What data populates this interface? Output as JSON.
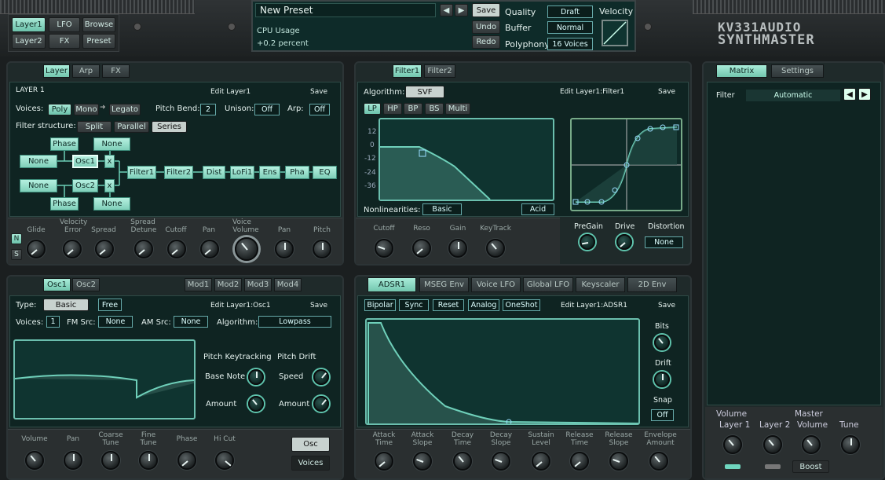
{
  "top": {
    "tabs": [
      "Layer1",
      "LFO",
      "Browse",
      "Layer2",
      "FX",
      "Preset"
    ],
    "active": "Layer1",
    "preset_name": "New Preset",
    "save": "Save",
    "undo": "Undo",
    "redo": "Redo",
    "cpu_label": "CPU Usage",
    "cpu_value": "+0.2 percent",
    "quality_label": "Quality",
    "quality": "Draft",
    "buffer_label": "Buffer",
    "buffer": "Normal",
    "polyphony_label": "Polyphony",
    "polyphony": "16 Voices",
    "velocity_label": "Velocity",
    "logo_top": "KV331AUDIO",
    "logo_bottom": "SYNTHMASTER"
  },
  "layer": {
    "tabs": [
      "Layer",
      "Arp",
      "FX"
    ],
    "title": "LAYER 1",
    "edit": "Edit Layer1",
    "save": "Save",
    "voices_label": "Voices:",
    "poly": "Poly",
    "mono": "Mono",
    "legato": "Legato",
    "pitch_bend_label": "Pitch Bend:",
    "pitch_bend": "2",
    "unison_label": "Unison:",
    "unison": "Off",
    "arp_label": "Arp:",
    "arp": "Off",
    "filter_structure_label": "Filter structure:",
    "split": "Split",
    "parallel": "Parallel",
    "series": "Series",
    "nodes": {
      "phase1": "Phase",
      "none1": "None",
      "noneA": "None",
      "osc1": "Osc1",
      "x1": "x",
      "filter1": "Filter1",
      "filter2": "Filter2",
      "dist": "Dist",
      "lofi": "LoFi1",
      "ens": "Ens",
      "pha": "Pha",
      "eq": "EQ",
      "noneB": "None",
      "osc2": "Osc2",
      "x2": "x",
      "phase2": "Phase",
      "none2": "None"
    },
    "groups": [
      "Velocity",
      "Spread",
      "Voice"
    ],
    "knobs": [
      "Glide",
      "Error",
      "Spread",
      "Detune",
      "Cutoff",
      "Pan",
      "Volume",
      "Pan",
      "Pitch"
    ],
    "n": "N",
    "s": "S"
  },
  "filter": {
    "tabs": [
      "Filter1",
      "Filter2"
    ],
    "algorithm_label": "Algorithm:",
    "algorithm": "SVF",
    "types": [
      "LP",
      "HP",
      "BP",
      "BS",
      "Multi"
    ],
    "edit": "Edit Layer1:Filter1",
    "save": "Save",
    "db": [
      "12",
      "0",
      "-12",
      "-24",
      "-36"
    ],
    "nonlin_label": "Nonlinearities:",
    "nonlin": "Basic",
    "acid": "Acid",
    "knobs": [
      "Cutoff",
      "Reso",
      "Gain",
      "KeyTrack"
    ],
    "dist_knobs": [
      "PreGain",
      "Drive",
      "Distortion"
    ],
    "dist_value": "None"
  },
  "matrix": {
    "tabs": [
      "Matrix",
      "Settings"
    ],
    "filter_label": "Filter",
    "filter_value": "Automatic",
    "volume_label": "Volume",
    "master_label": "Master",
    "knobs": [
      "Layer 1",
      "Layer 2",
      "Volume",
      "Tune"
    ],
    "boost": "Boost"
  },
  "osc": {
    "tabs": [
      "Osc1",
      "Osc2"
    ],
    "mod_tabs": [
      "Mod1",
      "Mod2",
      "Mod3",
      "Mod4"
    ],
    "type_label": "Type:",
    "type": "Basic",
    "free": "Free",
    "edit": "Edit Layer1:Osc1",
    "save": "Save",
    "voices_label": "Voices:",
    "voices": "1",
    "fm_label": "FM Src:",
    "fm": "None",
    "am_label": "AM Src:",
    "am": "None",
    "algo_label": "Algorithm:",
    "algo": "Lowpass",
    "pk_label": "Pitch Keytracking",
    "pd_label": "Pitch Drift",
    "base_note": "Base Note",
    "amount": "Amount",
    "speed": "Speed",
    "amount2": "Amount",
    "knobs": [
      "Volume",
      "Pan",
      "Coarse\nTune",
      "Fine\nTune",
      "Phase",
      "Hi Cut"
    ],
    "osc_btn": "Osc",
    "voices_btn": "Voices"
  },
  "env": {
    "tabs": [
      "ADSR1",
      "MSEG Env",
      "Voice LFO",
      "Global LFO",
      "Keyscaler",
      "2D Env"
    ],
    "opts": [
      "Bipolar",
      "Sync",
      "Reset",
      "Analog",
      "OneShot"
    ],
    "edit": "Edit Layer1:ADSR1",
    "save": "Save",
    "side": [
      "Bits",
      "Drift",
      "Snap"
    ],
    "snap": "Off",
    "knobs": [
      "Attack\nTime",
      "Attack\nSlope",
      "Decay\nTime",
      "Decay\nSlope",
      "Sustain\nLevel",
      "Release\nTime",
      "Release\nSlope",
      "Envelope\nAmount"
    ]
  }
}
